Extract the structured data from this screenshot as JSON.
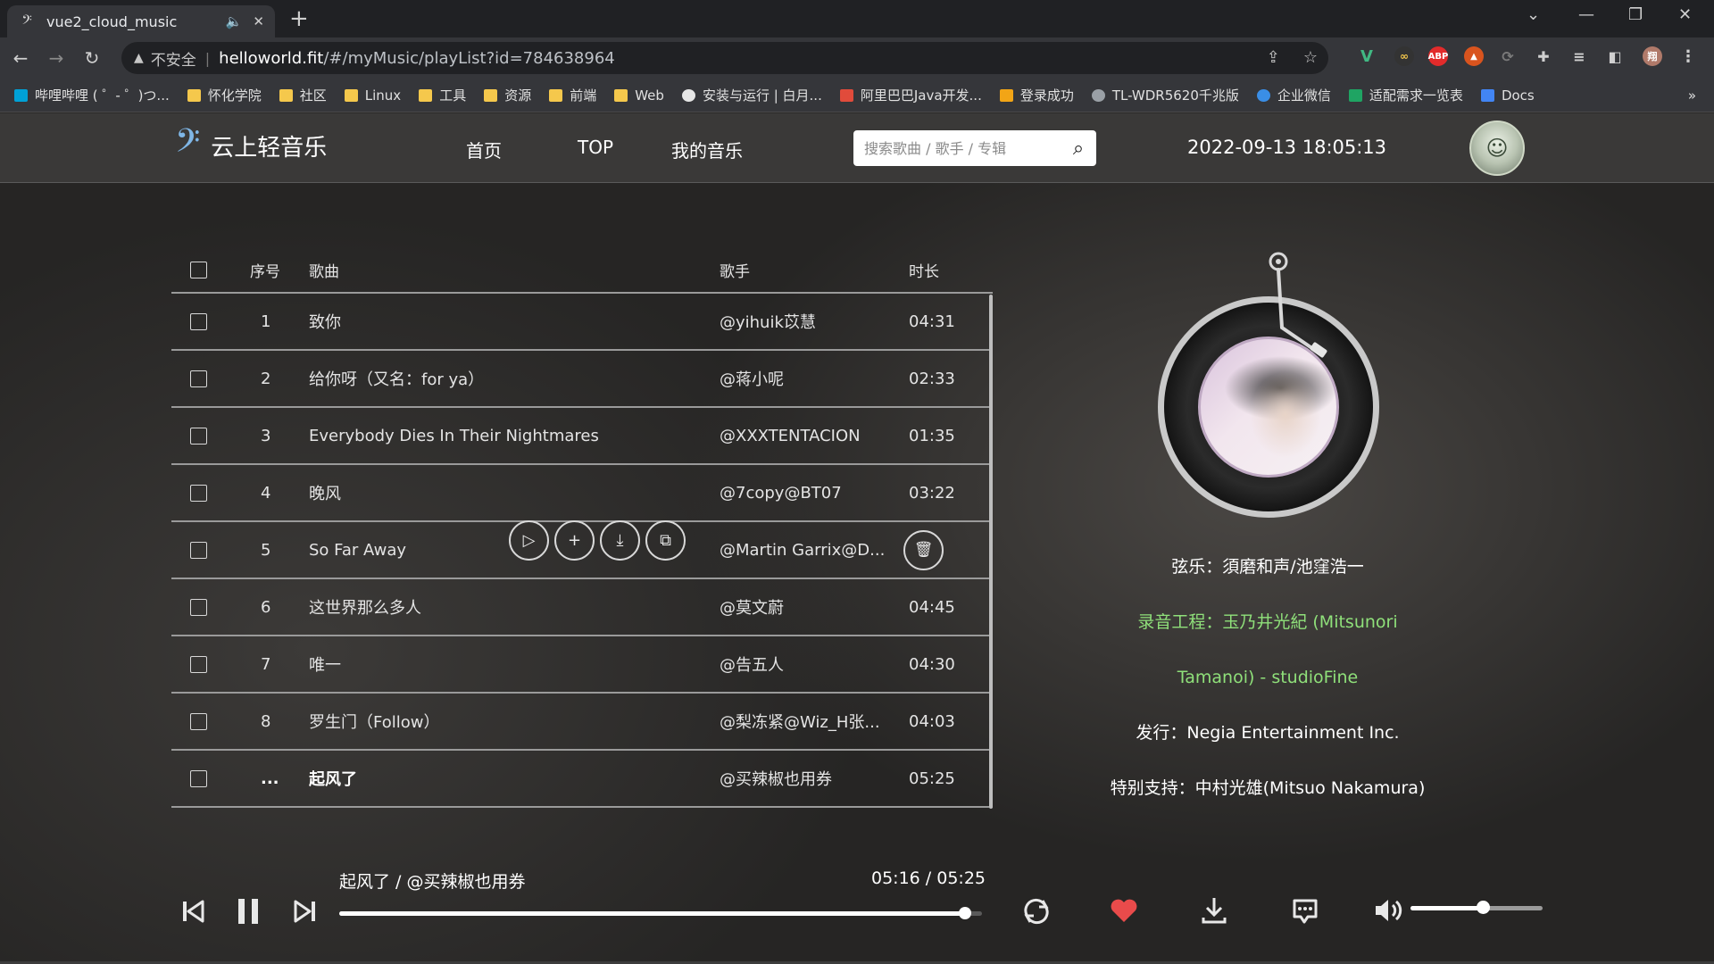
{
  "browser": {
    "tab_title": "vue2_cloud_music",
    "insecure_label": "不安全",
    "url_host": "helloworld.fit",
    "url_path": "/#/myMusic/playList?id=784638964",
    "bookmarks": [
      {
        "label": "哔哩哔哩 ( ゜- ゜)つ...",
        "icon": "bilibili-icon",
        "color": "#00a1d6"
      },
      {
        "label": "怀化学院",
        "icon": "folder-icon",
        "color": "#f5c84c"
      },
      {
        "label": "社区",
        "icon": "folder-icon",
        "color": "#f5c84c"
      },
      {
        "label": "Linux",
        "icon": "folder-icon",
        "color": "#f5c84c"
      },
      {
        "label": "工具",
        "icon": "folder-icon",
        "color": "#f5c84c"
      },
      {
        "label": "资源",
        "icon": "folder-icon",
        "color": "#f5c84c"
      },
      {
        "label": "前端",
        "icon": "folder-icon",
        "color": "#f5c84c"
      },
      {
        "label": "Web",
        "icon": "folder-icon",
        "color": "#f5c84c"
      },
      {
        "label": "安装与运行 | 白月...",
        "icon": "globe-icon",
        "color": "#e6e6e6"
      },
      {
        "label": "阿里巴巴Java开发...",
        "icon": "red-person-icon",
        "color": "#e14b3b"
      },
      {
        "label": "登录成功",
        "icon": "ep-icon",
        "color": "#f2a516"
      },
      {
        "label": "TL-WDR5620千兆版",
        "icon": "globe-icon",
        "color": "#9aa0a6"
      },
      {
        "label": "企业微信",
        "icon": "wecom-icon",
        "color": "#3a8ee6"
      },
      {
        "label": "适配需求一览表",
        "icon": "sheet-icon",
        "color": "#1fa463"
      },
      {
        "label": "Docs",
        "icon": "docs-icon",
        "color": "#4285f4"
      }
    ]
  },
  "app": {
    "logo_text": "云上轻音乐",
    "nav": [
      "首页",
      "TOP",
      "我的音乐"
    ],
    "search_placeholder": "搜索歌曲 / 歌手 / 专辑",
    "clock": "2022-09-13 18:05:13"
  },
  "playlist": {
    "headers": {
      "index": "序号",
      "song": "歌曲",
      "artist": "歌手",
      "duration": "时长"
    },
    "rows": [
      {
        "index": "1",
        "song": "致你",
        "artist": "@yihuik苡慧",
        "duration": "04:31"
      },
      {
        "index": "2",
        "song": "给你呀（又名：for ya）",
        "artist": "@蒋小呢",
        "duration": "02:33"
      },
      {
        "index": "3",
        "song": "Everybody Dies In Their Nightmares",
        "artist": "@XXXTENTACION",
        "duration": "01:35"
      },
      {
        "index": "4",
        "song": "晚风",
        "artist": "@7copy@BT07",
        "duration": "03:22"
      },
      {
        "index": "5",
        "song": "So Far Away",
        "artist": "@Martin Garrix@D...",
        "duration": ""
      },
      {
        "index": "6",
        "song": "这世界那么多人",
        "artist": "@莫文蔚",
        "duration": "04:45"
      },
      {
        "index": "7",
        "song": "唯一",
        "artist": "@告五人",
        "duration": "04:30"
      },
      {
        "index": "8",
        "song": "罗生门（Follow）",
        "artist": "@梨冻紧@Wiz_H张...",
        "duration": "04:03"
      },
      {
        "index": "...",
        "song": "起风了",
        "artist": "@买辣椒也用券",
        "duration": "05:25"
      }
    ]
  },
  "credits": [
    {
      "text": "弦乐：須磨和声/池窪浩一",
      "color": "#ffffff"
    },
    {
      "text": "录音工程：玉乃井光紀 (Mitsunori",
      "color": "#8fe07a"
    },
    {
      "text": "Tamanoi) - studioFine",
      "color": "#8fe07a"
    },
    {
      "text": "发行：Negia Entertainment Inc.",
      "color": "#ffffff"
    },
    {
      "text": "特别支持：中村光雄(Mitsuo Nakamura)",
      "color": "#ffffff"
    }
  ],
  "player": {
    "now_playing": "起风了 / @买辣椒也用券",
    "time": "05:16 / 05:25",
    "progress_fraction": 0.973,
    "volume_fraction": 0.55,
    "liked": true,
    "accent_like": "#e94b4b"
  }
}
